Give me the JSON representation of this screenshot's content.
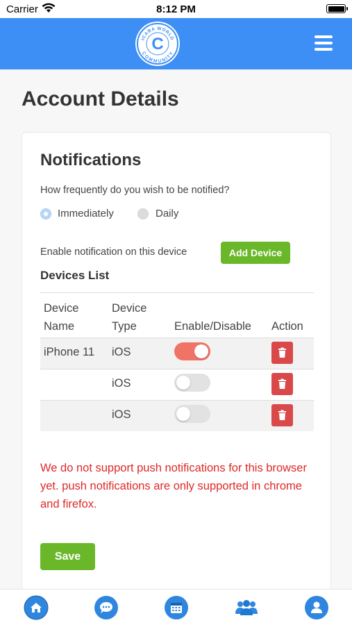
{
  "status_bar": {
    "carrier": "Carrier",
    "time": "8:12 PM"
  },
  "header": {
    "logo_text_top": "ICABA WORLD",
    "logo_text_bottom": "COMMUNITY",
    "logo_letter": "C",
    "menu_icon": "hamburger-menu-icon",
    "color": "#3d8ff5"
  },
  "page": {
    "title": "Account Details"
  },
  "notifications": {
    "title": "Notifications",
    "question": "How frequently do you wish to be notified?",
    "options": [
      {
        "label": "Immediately",
        "selected": true
      },
      {
        "label": "Daily",
        "selected": false
      }
    ],
    "enable_text": "Enable notification on this device",
    "add_device_label": "Add Device"
  },
  "devices": {
    "title": "Devices List",
    "columns": [
      "Device Name",
      "Device Type",
      "Enable/Disable",
      "Action"
    ],
    "rows": [
      {
        "name": "iPhone 11",
        "type": "iOS",
        "enabled": true
      },
      {
        "name": "",
        "type": "iOS",
        "enabled": false
      },
      {
        "name": "",
        "type": "iOS",
        "enabled": false
      }
    ],
    "action_icon": "trash-icon"
  },
  "warning": "We do not support push notifications for this browser yet. push notifications are only supported in chrome and firefox.",
  "save_label": "Save",
  "bottom_nav": [
    {
      "icon": "home-icon"
    },
    {
      "icon": "chat-icon"
    },
    {
      "icon": "calendar-icon"
    },
    {
      "icon": "group-icon"
    },
    {
      "icon": "profile-icon"
    }
  ],
  "colors": {
    "accent_green": "#6ab82a",
    "danger_red": "#d9494a",
    "toggle_on": "#f07466",
    "warning_text": "#e02828"
  }
}
